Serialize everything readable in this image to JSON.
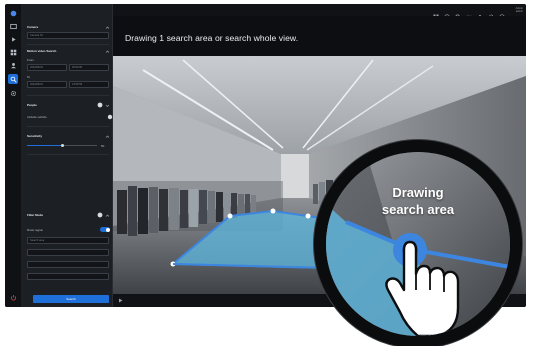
{
  "instruction": "Drawing 1 search area or search whole view.",
  "video_label": "Camera 01",
  "topbar": {
    "user_line1": "Admin",
    "user_line2": "admin",
    "icons": [
      "grid-icon",
      "clock-icon",
      "search-icon",
      "camera-icon",
      "bell-icon",
      "gear-icon",
      "help-icon"
    ]
  },
  "rail": {
    "icons": [
      "logo-icon",
      "live-view-icon",
      "playback-icon",
      "layout-icon",
      "people-icon",
      "smart-search-icon",
      "settings-icon"
    ],
    "active": "smart-search-icon"
  },
  "panel": {
    "camera_section": "Camera",
    "camera_value": "Camera 01",
    "time_section": "Motion video Search",
    "from_label": "From",
    "from_date": "2022/06/01",
    "from_time": "00:00:00",
    "to_label": "To",
    "to_date": "2022/06/01",
    "to_time": "23:59:59",
    "people_label": "People",
    "vehicle_label": "Include vehicle",
    "sensitivity_label": "Sensitivity",
    "sensitivity_value": "50",
    "sensitivity_level": 0.5,
    "filter_label": "Filter Mode",
    "region_label": "Draw region",
    "region_select": "Search area",
    "search_button": "Search"
  },
  "magnifier": {
    "line1": "Drawing",
    "line2": "search area"
  },
  "colors": {
    "accent": "#1e6fd9",
    "area_fill": "#5fb8e0",
    "area_stroke": "#3d86e0"
  }
}
